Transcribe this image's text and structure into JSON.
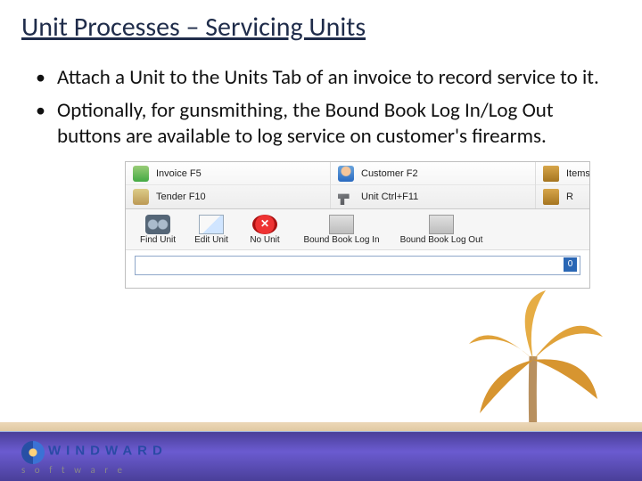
{
  "title": "Unit Processes – Servicing Units",
  "bullets": [
    "Attach a Unit to the Units Tab of an invoice to record service to it.",
    "Optionally, for gunsmithing, the Bound Book Log In/Log Out buttons are available to log service on customer's firearms."
  ],
  "ribbon": {
    "col1": [
      {
        "icon": "money-icon",
        "label": "Invoice F5"
      },
      {
        "icon": "cash-icon",
        "label": "Tender F10"
      }
    ],
    "col2": [
      {
        "icon": "person-icon",
        "label": "Customer F2"
      },
      {
        "icon": "gun-icon",
        "label": "Unit Ctrl+F11"
      }
    ],
    "col3": [
      {
        "icon": "box-icon",
        "label": "Items"
      },
      {
        "icon": "box-plus-icon",
        "label": "R"
      }
    ]
  },
  "toolbar": [
    {
      "icon": "binoculars-icon",
      "label": "Find Unit"
    },
    {
      "icon": "edit-icon",
      "label": "Edit Unit"
    },
    {
      "icon": "cancel-icon",
      "label": "No Unit"
    },
    {
      "icon": "book-icon",
      "label": "Bound Book Log In"
    },
    {
      "icon": "book-icon",
      "label": "Bound Book Log Out"
    }
  ],
  "input_value": "",
  "caret_badge": "0",
  "logo": {
    "brand": "WINDWARD",
    "sub": "s  o  f  t  w  a  r  e"
  }
}
